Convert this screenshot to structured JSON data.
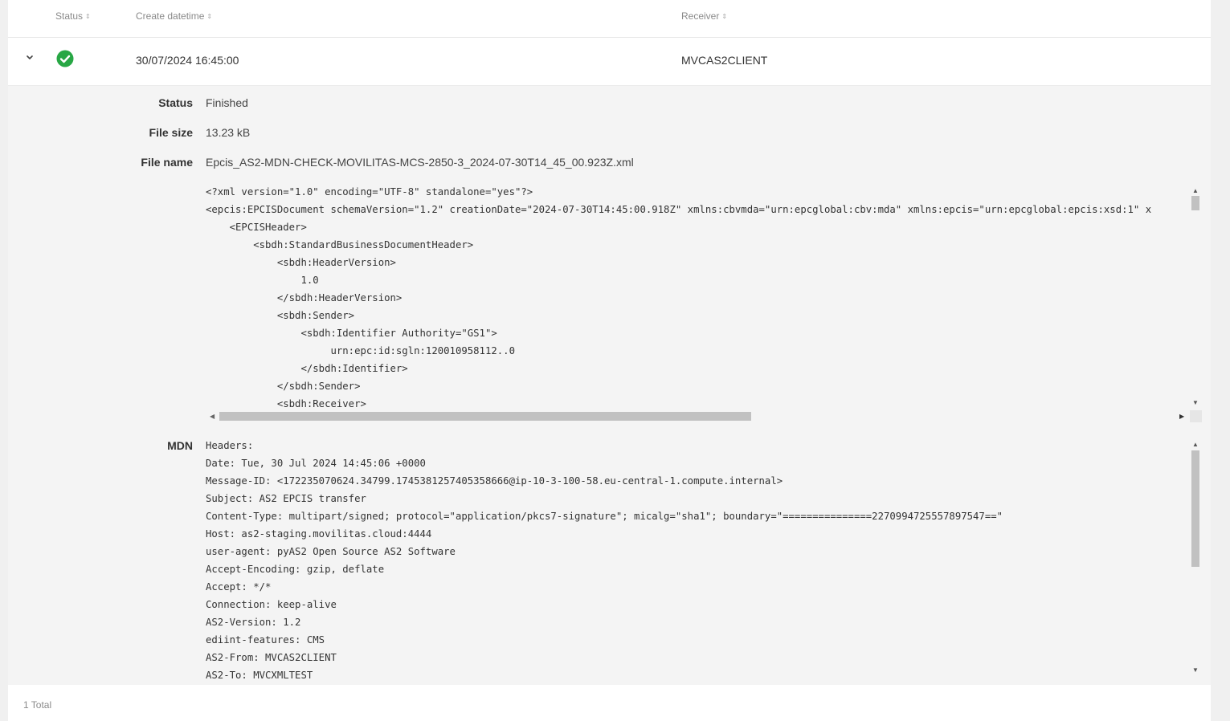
{
  "table": {
    "columns": {
      "status": "Status",
      "create_datetime": "Create datetime",
      "receiver": "Receiver"
    },
    "row": {
      "status_icon": "check-circle-icon",
      "status_color": "#28a745",
      "create_datetime": "30/07/2024 16:45:00",
      "receiver": "MVCAS2CLIENT"
    }
  },
  "detail": {
    "status_label": "Status",
    "status_value": "Finished",
    "file_size_label": "File size",
    "file_size_value": "13.23 kB",
    "file_name_label": "File name",
    "file_name_value": "Epcis_AS2-MDN-CHECK-MOVILITAS-MCS-2850-3_2024-07-30T14_45_00.923Z.xml",
    "xml_content": "<?xml version=\"1.0\" encoding=\"UTF-8\" standalone=\"yes\"?>\n<epcis:EPCISDocument schemaVersion=\"1.2\" creationDate=\"2024-07-30T14:45:00.918Z\" xmlns:cbvmda=\"urn:epcglobal:cbv:mda\" xmlns:epcis=\"urn:epcglobal:epcis:xsd:1\" x\n    <EPCISHeader>\n        <sbdh:StandardBusinessDocumentHeader>\n            <sbdh:HeaderVersion>\n                1.0\n            </sbdh:HeaderVersion>\n            <sbdh:Sender>\n                <sbdh:Identifier Authority=\"GS1\">\n                     urn:epc:id:sgln:120010958112..0\n                </sbdh:Identifier>\n            </sbdh:Sender>\n            <sbdh:Receiver>",
    "mdn_label": "MDN",
    "mdn_content": "Headers:\nDate: Tue, 30 Jul 2024 14:45:06 +0000\nMessage-ID: <172235070624.34799.1745381257405358666@ip-10-3-100-58.eu-central-1.compute.internal>\nSubject: AS2 EPCIS transfer\nContent-Type: multipart/signed; protocol=\"application/pkcs7-signature\"; micalg=\"sha1\"; boundary=\"===============2270994725557897547==\"\nHost: as2-staging.movilitas.cloud:4444\nuser-agent: pyAS2 Open Source AS2 Software\nAccept-Encoding: gzip, deflate\nAccept: */*\nConnection: keep-alive\nAS2-Version: 1.2\nediint-features: CMS\nAS2-From: MVCAS2CLIENT\nAS2-To: MVCXMLTEST"
  },
  "footer": {
    "total": "1 Total"
  }
}
